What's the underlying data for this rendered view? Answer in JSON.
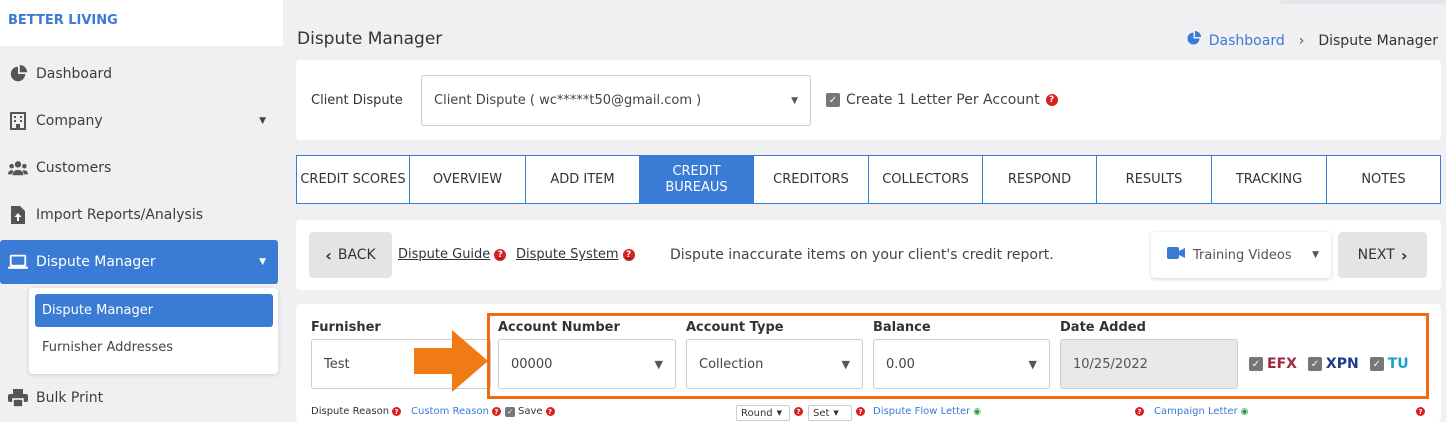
{
  "brand": "BETTER LIVING",
  "sidebar": {
    "items": [
      {
        "label": "Dashboard",
        "icon": "dashboard-icon"
      },
      {
        "label": "Company",
        "icon": "building-icon"
      },
      {
        "label": "Customers",
        "icon": "users-icon"
      },
      {
        "label": "Import Reports/Analysis",
        "icon": "file-upload-icon"
      },
      {
        "label": "Dispute Manager",
        "icon": "laptop-icon"
      },
      {
        "label": "Bulk Print",
        "icon": "printer-icon"
      }
    ],
    "submenu": [
      "Dispute Manager",
      "Furnisher Addresses"
    ]
  },
  "page": {
    "title": "Dispute Manager",
    "breadcrumb": {
      "home": "Dashboard",
      "current": "Dispute Manager"
    }
  },
  "client": {
    "label": "Client Dispute",
    "value": "Client Dispute ( wc*****t50@gmail.com )",
    "letter_option": "Create 1 Letter Per Account"
  },
  "tabs": [
    "CREDIT SCORES",
    "OVERVIEW",
    "ADD ITEM",
    "CREDIT BUREAUS",
    "CREDITORS",
    "COLLECTORS",
    "RESPOND",
    "RESULTS",
    "TRACKING",
    "NOTES"
  ],
  "toolbar": {
    "back": "BACK",
    "guide": "Dispute Guide",
    "system": "Dispute System",
    "info": "Dispute inaccurate items on your client's credit report.",
    "training": "Training Videos",
    "next": "NEXT"
  },
  "form": {
    "furnisher": {
      "label": "Furnisher",
      "value": "Test"
    },
    "account_number": {
      "label": "Account Number",
      "value": "00000"
    },
    "account_type": {
      "label": "Account Type",
      "value": "Collection"
    },
    "balance": {
      "label": "Balance",
      "value": "0.00"
    },
    "date_added": {
      "label": "Date Added",
      "value": "10/25/2022"
    },
    "bureaus": [
      "EFX",
      "XPN",
      "TU"
    ]
  },
  "bottom": {
    "dispute_reason": "Dispute Reason",
    "custom_reason": "Custom Reason",
    "save": "Save",
    "round": "Round",
    "set": "Set",
    "flow_letter": "Dispute Flow Letter",
    "campaign_letter": "Campaign Letter"
  },
  "colors": {
    "accent": "#3a7bd5",
    "highlight": "#f06a0f",
    "efx": "#9c2a3c",
    "xpn": "#1f3a8a",
    "tu": "#1aa0c8"
  }
}
